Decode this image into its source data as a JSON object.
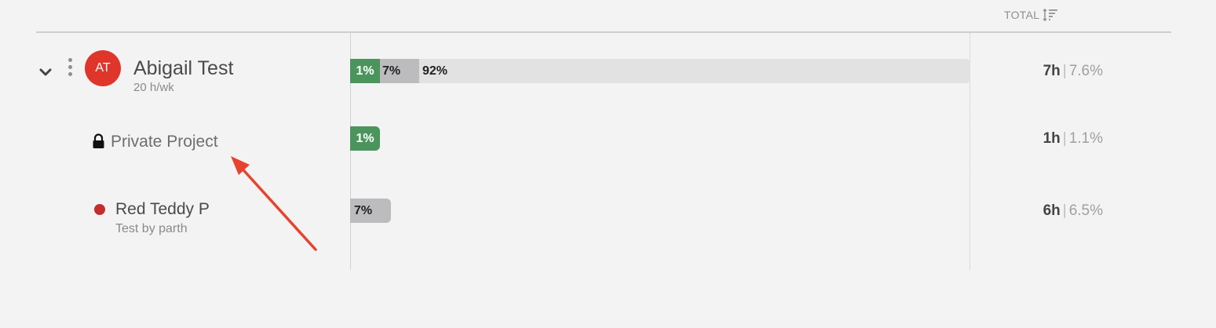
{
  "header": {
    "total_label": "TOTAL",
    "sort_icon": "sort-icon"
  },
  "member": {
    "initials": "AT",
    "avatar_color": "#e0352b",
    "name": "Abigail Test",
    "capacity": "20 h/wk",
    "bar": {
      "segments": [
        {
          "label": "1%",
          "value": 1,
          "color": "#4c945d"
        },
        {
          "label": "7%",
          "value": 7,
          "color": "#bcbcbe"
        },
        {
          "label": "92%",
          "value": 92,
          "color": "#e2e2e2"
        }
      ]
    },
    "total": {
      "hours": "7h",
      "separator": "|",
      "percent": "7.6%"
    }
  },
  "projects": [
    {
      "name": "Private Project",
      "icon": "lock-icon",
      "bar": {
        "label": "1%",
        "value": 1,
        "color": "#4c945d"
      },
      "total": {
        "hours": "1h",
        "separator": "|",
        "percent": "1.1%"
      }
    },
    {
      "name": "Red Teddy P",
      "client": "Test by parth",
      "dot_color": "#c62c2c",
      "bar": {
        "label": "7%",
        "value": 7,
        "color": "#bcbcbe"
      },
      "total": {
        "hours": "6h",
        "separator": "|",
        "percent": "6.5%"
      }
    }
  ],
  "annotation": {
    "arrow_color": "#e8432e"
  }
}
